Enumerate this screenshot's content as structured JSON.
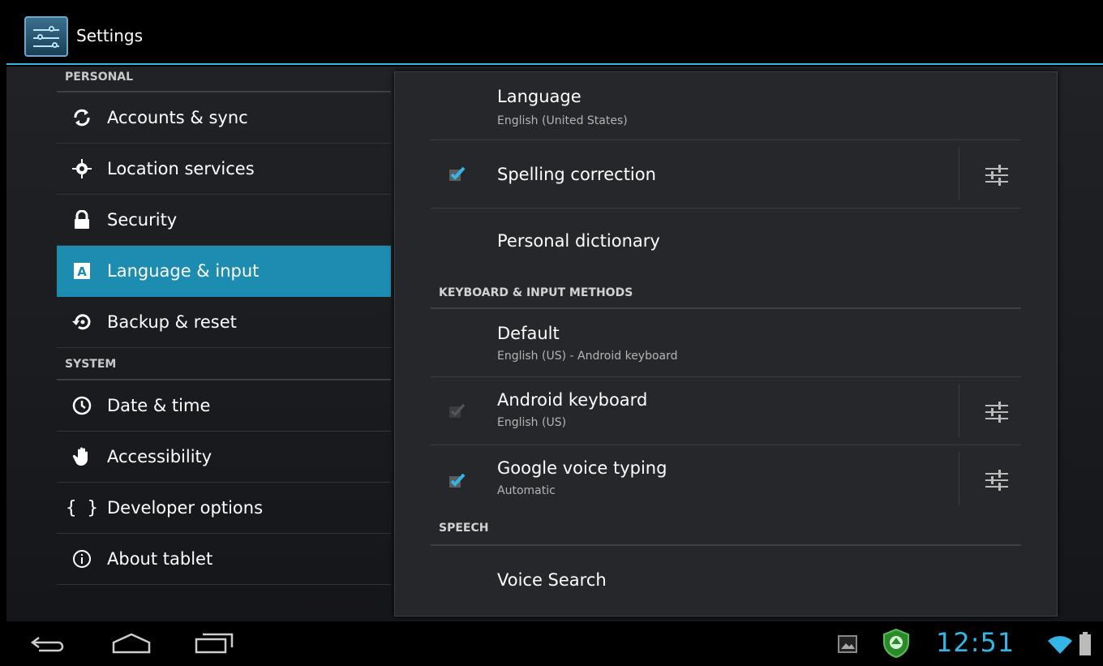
{
  "app": {
    "title": "Settings"
  },
  "sidebar": {
    "personal_header": "PERSONAL",
    "system_header": "SYSTEM",
    "personal_items": [
      {
        "label": "Accounts & sync",
        "icon": "sync-icon"
      },
      {
        "label": "Location services",
        "icon": "location-icon"
      },
      {
        "label": "Security",
        "icon": "lock-icon"
      },
      {
        "label": "Language & input",
        "icon": "language-icon",
        "active": true
      },
      {
        "label": "Backup & reset",
        "icon": "backup-icon"
      }
    ],
    "system_items": [
      {
        "label": "Date & time",
        "icon": "clock-icon"
      },
      {
        "label": "Accessibility",
        "icon": "hand-icon"
      },
      {
        "label": "Developer options",
        "icon": "braces-icon"
      },
      {
        "label": "About tablet",
        "icon": "info-icon"
      }
    ]
  },
  "main": {
    "language": {
      "title": "Language",
      "summary": "English (United States)"
    },
    "spelling": {
      "title": "Spelling correction",
      "checked": true
    },
    "dictionary": {
      "title": "Personal dictionary"
    },
    "keyboard_header": "KEYBOARD & INPUT METHODS",
    "default": {
      "title": "Default",
      "summary": "English (US) - Android keyboard"
    },
    "android_keyboard": {
      "title": "Android keyboard",
      "summary": "English (US)",
      "checked": true,
      "disabled": true
    },
    "voice_typing": {
      "title": "Google voice typing",
      "summary": "Automatic",
      "checked": true
    },
    "speech_header": "SPEECH",
    "voice_search": {
      "title": "Voice Search"
    }
  },
  "statusbar": {
    "time": "12:51"
  },
  "colors": {
    "accent": "#33b5e5",
    "selected": "#1c8cb0"
  }
}
